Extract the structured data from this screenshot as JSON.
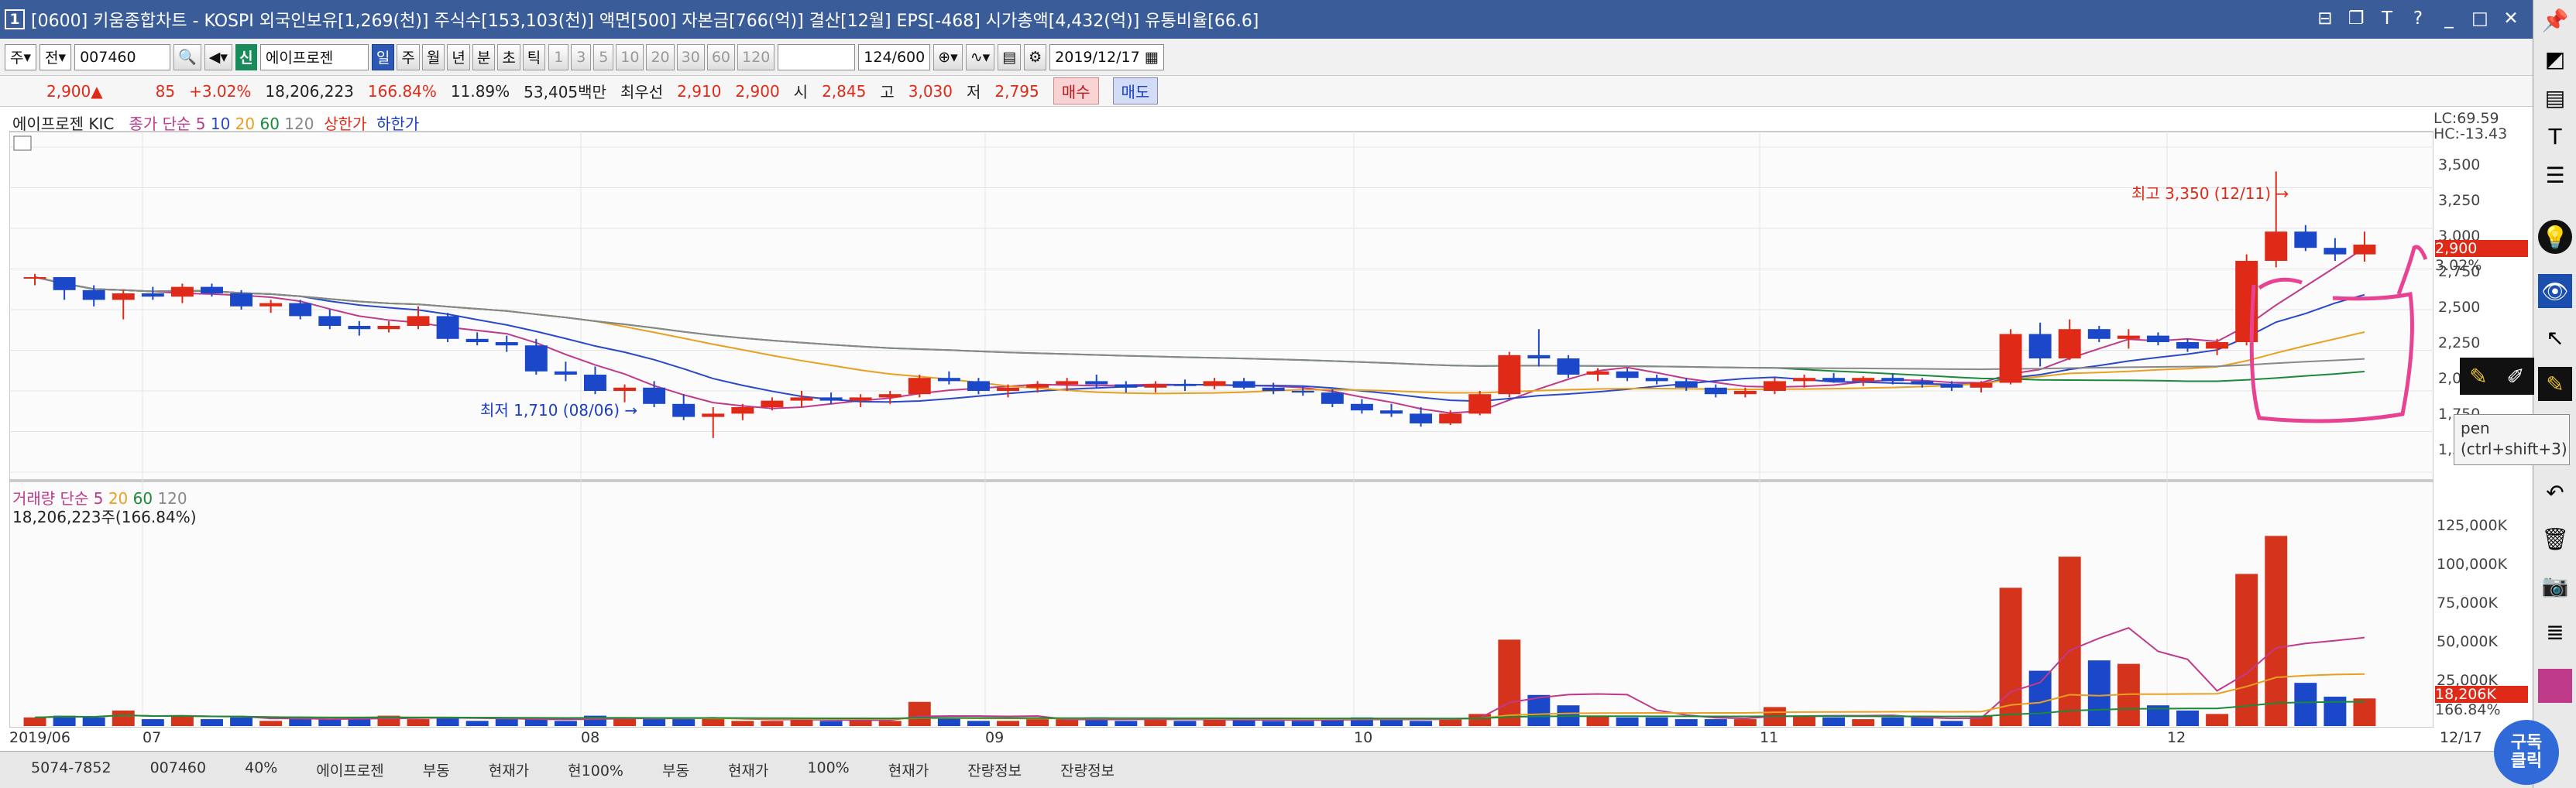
{
  "window": {
    "id": "1",
    "title": "[0600] 키움종합차트 - KOSPI 외국인보유[1,269(천)] 주식수[153,103(천)] 액면[500] 자본금[766(억)] 결산[12월] EPS[-468] 시가총액[4,432(억)] 유통비율[66.6]"
  },
  "toolbar": {
    "period": "주",
    "mode": "전",
    "code": "007460",
    "stock_name": "에이프로젠",
    "badge": "신",
    "types": [
      "일",
      "주",
      "월",
      "년",
      "분",
      "초",
      "틱"
    ],
    "minutes": [
      "1",
      "3",
      "5",
      "10",
      "20",
      "30",
      "60",
      "120"
    ],
    "count": "124/600",
    "date": "2019/12/17"
  },
  "price": {
    "price": "2,900▲",
    "change": "85",
    "rate": "+3.02%",
    "volume": "18,206,223",
    "vol_rate": "166.84%",
    "turnover": "11.89%",
    "amount": "53,405백만",
    "best": "최우선",
    "ask": "2,910",
    "bid": "2,900",
    "open_lbl": "시",
    "open": "2,845",
    "high_lbl": "고",
    "high": "3,030",
    "low_lbl": "저",
    "low": "2,795",
    "buy": "매수",
    "sell": "매도"
  },
  "legend": {
    "name": "에이프로젠 KIC",
    "ma_lbl": "종가 단순",
    "ma5": "5",
    "ma10": "10",
    "ma20": "20",
    "ma60": "60",
    "ma120": "120",
    "upper": "상한가",
    "lower": "하한가"
  },
  "vol_legend": {
    "lbl": "거래량 단순",
    "v5": "5",
    "v20": "20",
    "v60": "60",
    "v120": "120",
    "value": "18,206,223주(166.84%)"
  },
  "annot": {
    "high": "최고 3,350 (12/11) →",
    "low": "최저 1,710 (08/06) →"
  },
  "axis": {
    "lc": "LC:69.59",
    "hc": "HC:-13.43",
    "ticks": [
      "3,500",
      "3,250",
      "3,000",
      "2,750",
      "2,500",
      "2,250",
      "2,000",
      "1,750",
      "1,500"
    ],
    "cur": "2,900",
    "cur_rate": "3.02%",
    "vticks": [
      "125,000K",
      "100,000K",
      "75,000K",
      "50,000K",
      "25,000K"
    ],
    "vcur": "18,206K",
    "vcur_rate": "166.84%"
  },
  "dates": [
    "2019/06",
    "07",
    "08",
    "09",
    "10",
    "11",
    "12",
    "12/17"
  ],
  "bottom": [
    "5074-7852",
    "007460",
    "40%",
    "에이프로젠",
    "부동",
    "현재가",
    "현100%",
    "부동",
    "현재가",
    "100%",
    "현재가",
    "잔량정보",
    "잔량정보"
  ],
  "tooltip": {
    "line1": "pen",
    "line2": "(ctrl+shift+3)"
  },
  "logo": "구독\n클릭",
  "chart_data": {
    "type": "candlestick",
    "x_range": [
      "2019/06",
      "2019/12/17"
    ],
    "ylim": [
      1500,
      3500
    ],
    "candles": [
      [
        2700,
        2720,
        2650,
        2700
      ],
      [
        2700,
        2690,
        2560,
        2620
      ],
      [
        2620,
        2650,
        2520,
        2560
      ],
      [
        2560,
        2620,
        2440,
        2600
      ],
      [
        2600,
        2640,
        2560,
        2580
      ],
      [
        2580,
        2660,
        2540,
        2640
      ],
      [
        2640,
        2660,
        2580,
        2600
      ],
      [
        2600,
        2620,
        2500,
        2520
      ],
      [
        2520,
        2560,
        2480,
        2540
      ],
      [
        2540,
        2560,
        2440,
        2460
      ],
      [
        2460,
        2500,
        2380,
        2400
      ],
      [
        2400,
        2430,
        2340,
        2380
      ],
      [
        2380,
        2430,
        2360,
        2400
      ],
      [
        2400,
        2520,
        2380,
        2460
      ],
      [
        2460,
        2480,
        2300,
        2320
      ],
      [
        2320,
        2360,
        2280,
        2300
      ],
      [
        2300,
        2340,
        2240,
        2280
      ],
      [
        2280,
        2320,
        2100,
        2120
      ],
      [
        2120,
        2180,
        2060,
        2100
      ],
      [
        2100,
        2150,
        1980,
        2000
      ],
      [
        2000,
        2040,
        1930,
        2020
      ],
      [
        2020,
        2060,
        1900,
        1920
      ],
      [
        1920,
        1980,
        1820,
        1840
      ],
      [
        1840,
        1900,
        1710,
        1860
      ],
      [
        1860,
        1920,
        1820,
        1900
      ],
      [
        1900,
        1960,
        1880,
        1940
      ],
      [
        1940,
        2000,
        1900,
        1960
      ],
      [
        1960,
        1990,
        1920,
        1940
      ],
      [
        1940,
        1980,
        1900,
        1960
      ],
      [
        1960,
        2000,
        1920,
        1980
      ],
      [
        1980,
        2100,
        1960,
        2080
      ],
      [
        2080,
        2120,
        2040,
        2060
      ],
      [
        2060,
        2080,
        1980,
        2000
      ],
      [
        2000,
        2040,
        1960,
        2020
      ],
      [
        2020,
        2060,
        1990,
        2040
      ],
      [
        2040,
        2080,
        2000,
        2060
      ],
      [
        2060,
        2100,
        2020,
        2040
      ],
      [
        2040,
        2060,
        1990,
        2020
      ],
      [
        2020,
        2060,
        1990,
        2040
      ],
      [
        2040,
        2070,
        2000,
        2030
      ],
      [
        2030,
        2080,
        2010,
        2060
      ],
      [
        2060,
        2080,
        2010,
        2020
      ],
      [
        2020,
        2050,
        1980,
        2000
      ],
      [
        2000,
        2030,
        1970,
        1990
      ],
      [
        1990,
        2010,
        1900,
        1920
      ],
      [
        1920,
        1950,
        1860,
        1880
      ],
      [
        1880,
        1920,
        1840,
        1860
      ],
      [
        1860,
        1900,
        1780,
        1800
      ],
      [
        1800,
        1880,
        1790,
        1860
      ],
      [
        1860,
        2000,
        1850,
        1980
      ],
      [
        1980,
        2240,
        1960,
        2220
      ],
      [
        2220,
        2380,
        2150,
        2200
      ],
      [
        2200,
        2220,
        2080,
        2100
      ],
      [
        2100,
        2140,
        2060,
        2120
      ],
      [
        2120,
        2140,
        2060,
        2080
      ],
      [
        2080,
        2100,
        2040,
        2060
      ],
      [
        2060,
        2080,
        2000,
        2020
      ],
      [
        2020,
        2040,
        1960,
        1980
      ],
      [
        1980,
        2020,
        1960,
        2000
      ],
      [
        2000,
        2080,
        1980,
        2060
      ],
      [
        2060,
        2100,
        2020,
        2080
      ],
      [
        2080,
        2110,
        2050,
        2060
      ],
      [
        2060,
        2090,
        2030,
        2080
      ],
      [
        2080,
        2110,
        2040,
        2060
      ],
      [
        2060,
        2080,
        2020,
        2040
      ],
      [
        2040,
        2060,
        2000,
        2020
      ],
      [
        2020,
        2060,
        1990,
        2050
      ],
      [
        2050,
        2380,
        2040,
        2350
      ],
      [
        2350,
        2420,
        2150,
        2200
      ],
      [
        2200,
        2440,
        2190,
        2380
      ],
      [
        2380,
        2400,
        2300,
        2320
      ],
      [
        2320,
        2380,
        2260,
        2340
      ],
      [
        2340,
        2360,
        2280,
        2300
      ],
      [
        2300,
        2320,
        2240,
        2260
      ],
      [
        2260,
        2320,
        2220,
        2300
      ],
      [
        2300,
        2840,
        2280,
        2800
      ],
      [
        2800,
        3350,
        2760,
        2980
      ],
      [
        2980,
        3020,
        2860,
        2880
      ],
      [
        2880,
        2940,
        2800,
        2840
      ],
      [
        2840,
        2980,
        2795,
        2900
      ]
    ],
    "volumes": [
      5,
      6,
      5,
      9,
      4,
      6,
      4,
      5,
      3,
      4,
      4,
      5,
      6,
      4,
      5,
      3,
      4,
      4,
      3,
      6,
      5,
      4,
      4,
      5,
      3,
      3,
      4,
      3,
      4,
      3,
      14,
      5,
      3,
      3,
      4,
      4,
      5,
      3,
      4,
      3,
      4,
      4,
      3,
      3,
      4,
      5,
      4,
      3,
      4,
      7,
      50,
      18,
      12,
      6,
      5,
      5,
      4,
      4,
      4,
      11,
      6,
      5,
      4,
      5,
      5,
      3,
      6,
      80,
      32,
      98,
      38,
      36,
      12,
      9,
      7,
      88,
      110,
      25,
      17,
      16
    ]
  }
}
